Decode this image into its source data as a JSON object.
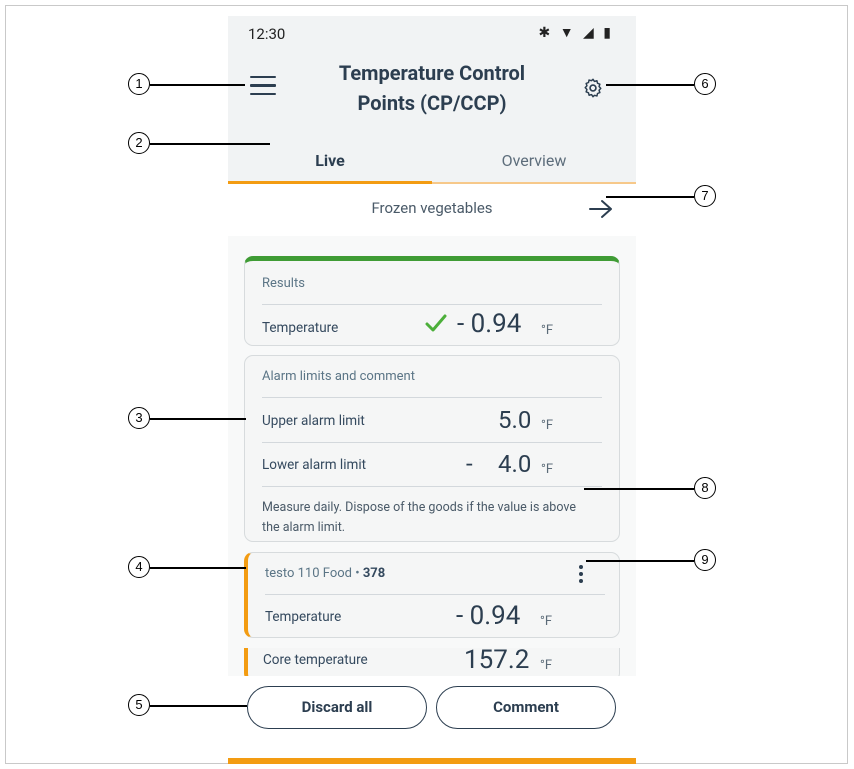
{
  "status_bar": {
    "time": "12:30",
    "icons": "✱ ▼ ◢ ▮"
  },
  "app_bar": {
    "title": "Temperature Control Points (CP/CCP)"
  },
  "tabs": [
    {
      "label": "Live"
    },
    {
      "label": "Overview"
    }
  ],
  "subheader": {
    "label": "Frozen vegetables"
  },
  "results": {
    "heading": "Results",
    "temperature_label": "Temperature",
    "temperature_value": "- 0.94",
    "unit": "°F"
  },
  "alarm": {
    "heading": "Alarm limits and comment",
    "upper_label": "Upper alarm limit",
    "upper_value": "5.0",
    "lower_label": "Lower alarm limit",
    "lower_sign": "-",
    "lower_value": "4.0",
    "unit": "°F",
    "comment": "Measure daily. Dispose of the goods if the value is above the alarm limit."
  },
  "probe": {
    "name": "testo 110 Food",
    "separator": " • ",
    "id": "378",
    "temperature_label": "Temperature",
    "temperature_value": "- 0.94",
    "unit": "°F"
  },
  "core": {
    "label": "Core temperature",
    "value": "157.2",
    "unit": "°F"
  },
  "buttons": {
    "discard": "Discard all",
    "comment": "Comment"
  },
  "callouts": [
    "1",
    "2",
    "3",
    "4",
    "5",
    "6",
    "7",
    "8",
    "9"
  ],
  "colors": {
    "accent": "#f39c12",
    "ok": "#3f9c35",
    "text": "#2c3e50"
  }
}
